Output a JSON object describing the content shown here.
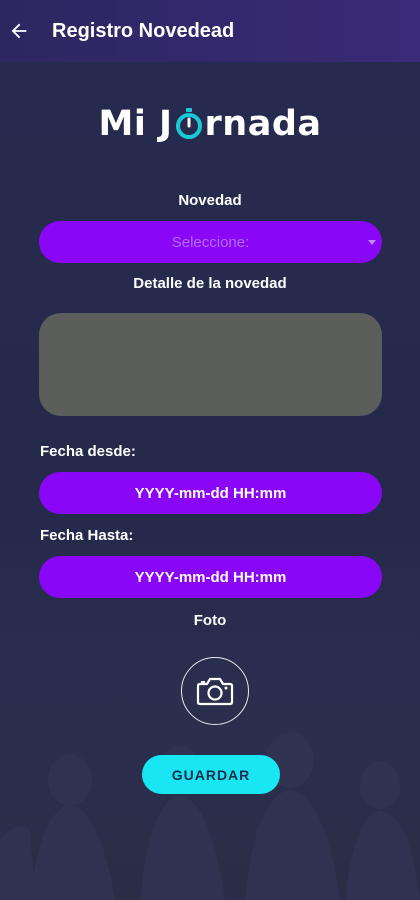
{
  "header": {
    "back_icon": "arrow-left-icon",
    "title": "Registro Novedead"
  },
  "logo": {
    "text_left": "Mi J",
    "text_right": "rnada",
    "stopwatch_icon": "stopwatch-icon"
  },
  "form": {
    "novedad_label": "Novedad",
    "novedad_select": {
      "selected": "Seleccione:",
      "arrow_icon": "caret-down-icon"
    },
    "detalle_label": "Detalle de la novedad",
    "detalle_value": "",
    "fecha_desde_label": "Fecha desde:",
    "fecha_desde_value": "YYYY-mm-dd HH:mm",
    "fecha_hasta_label": "Fecha Hasta:",
    "fecha_hasta_value": "YYYY-mm-dd HH:mm",
    "foto_label": "Foto",
    "camera_icon": "camera-icon",
    "save_label": "GUARDAR"
  },
  "colors": {
    "accent_purple": "#8a06f7",
    "accent_cyan": "#18e6f2",
    "logo_ring": "#18c9d6",
    "background": "#252a4a",
    "textarea_bg": "#5b5e5a"
  }
}
